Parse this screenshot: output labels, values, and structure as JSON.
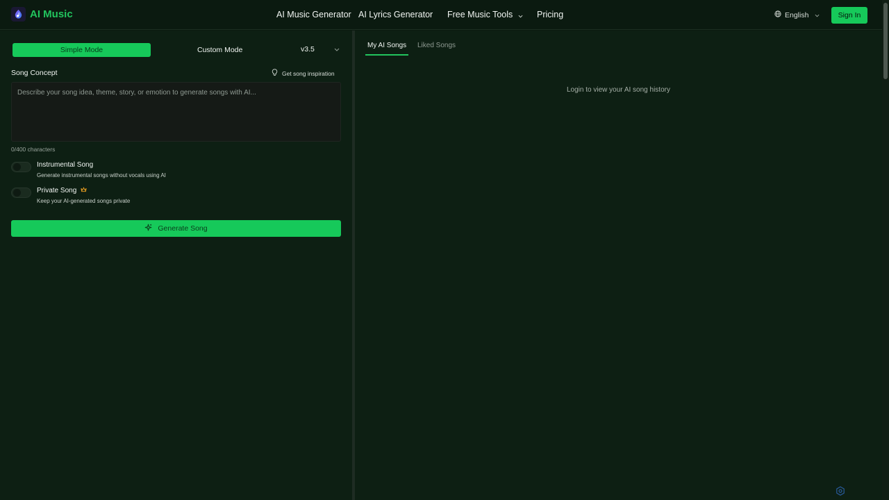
{
  "brand": {
    "name": "AI Music",
    "logo_icon": "music-note-icon",
    "accent": "#22c55e"
  },
  "nav": {
    "links": [
      {
        "label": "AI Music Generator"
      },
      {
        "label": "AI Lyrics Generator"
      },
      {
        "label": "Free Music Tools",
        "has_dropdown": true
      },
      {
        "label": "Pricing"
      }
    ],
    "language": "English",
    "sign_in": "Sign In"
  },
  "generator": {
    "modes": {
      "simple": "Simple Mode",
      "custom": "Custom Mode",
      "selected": "simple"
    },
    "version": "v3.5",
    "concept_title": "Song Concept",
    "inspiration_label": "Get song inspiration",
    "concept_value": "",
    "concept_placeholder": "Describe your song idea, theme, story, or emotion to generate songs with AI...",
    "char_count": "0/400 characters",
    "options": [
      {
        "title": "Instrumental Song",
        "description": "Generate instrumental songs without vocals using AI",
        "enabled": false
      },
      {
        "title": "Private Song",
        "description": "Keep your AI-generated songs private",
        "enabled": false,
        "badge_icon": "crown-icon"
      }
    ],
    "generate_label": "Generate Song"
  },
  "library": {
    "tabs": [
      {
        "label": "My AI Songs",
        "active": true
      },
      {
        "label": "Liked Songs",
        "active": false
      }
    ],
    "empty_message": "Login to view your AI song history"
  }
}
